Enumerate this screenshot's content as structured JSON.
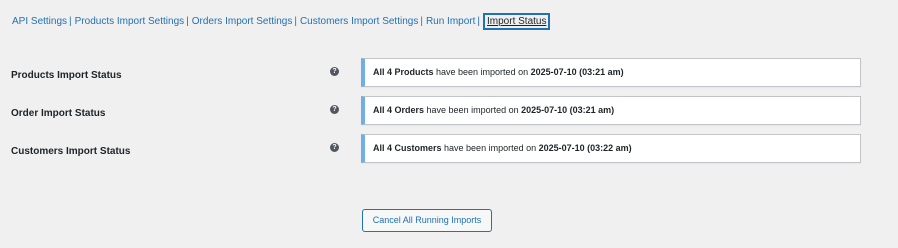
{
  "nav": {
    "tabs": [
      {
        "label": "API Settings",
        "active": false
      },
      {
        "label": "Products Import Settings",
        "active": false
      },
      {
        "label": "Orders Import Settings",
        "active": false
      },
      {
        "label": "Customers Import Settings",
        "active": false
      },
      {
        "label": "Run Import",
        "active": false
      },
      {
        "label": "Import Status",
        "active": true
      }
    ],
    "separator": "|"
  },
  "status_rows": [
    {
      "label": "Products Import Status",
      "help_icon": "question-circle-icon",
      "message": {
        "strong_count": "All 4 Products",
        "middle": " have been imported on ",
        "strong_date": "2025-07-10 (03:21 am)"
      }
    },
    {
      "label": "Order Import Status",
      "help_icon": "question-circle-icon",
      "message": {
        "strong_count": "All 4 Orders",
        "middle": " have been imported on ",
        "strong_date": "2025-07-10 (03:21 am)"
      }
    },
    {
      "label": "Customers Import Status",
      "help_icon": "question-circle-icon",
      "message": {
        "strong_count": "All 4 Customers",
        "middle": " have been imported on ",
        "strong_date": "2025-07-10 (03:22 am)"
      }
    }
  ],
  "actions": {
    "cancel_label": "Cancel All Running Imports"
  },
  "colors": {
    "link": "#2271b1",
    "notice_accent": "#72aee6",
    "background": "#f0f0f1",
    "help_icon": "#50575e"
  }
}
